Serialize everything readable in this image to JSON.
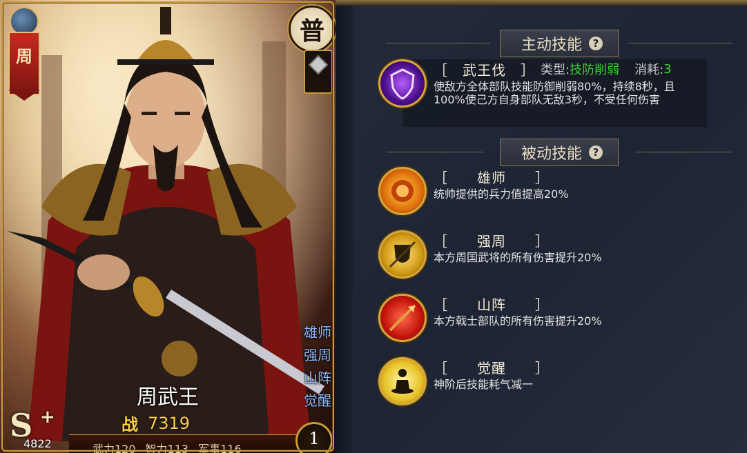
{
  "card": {
    "banner_char": "周",
    "grade_char": "普",
    "skill_tags": [
      "雄师",
      "强周",
      "山阵",
      "觉醒"
    ],
    "hero_name": "周武王",
    "power_label": "战",
    "power_value": "7319",
    "rank_letter": "S",
    "rank_plus": "+",
    "score": "4822",
    "stats": [
      "武力120",
      "智力113",
      "军事116"
    ],
    "level": "1"
  },
  "active_section": {
    "title": "主动技能",
    "help": "?",
    "skill": {
      "icon": "shield-burst-icon",
      "name": "［　武王伐　］",
      "type_label": "类型:",
      "type_value": "技防削弱",
      "cost_label": "消耗:",
      "cost_value": "3",
      "desc_line1": "使敌方全体部队技能防御削弱80%，持续8秒，且",
      "desc_line2": "100%使己方自身部队无敌3秒，不受任何伤害"
    }
  },
  "passive_section": {
    "title": "被动技能",
    "help": "?",
    "skills": [
      {
        "icon": "lion-icon",
        "name": "［　　雄师　　］",
        "desc": "统帅提供的兵力值提高20%"
      },
      {
        "icon": "shield-spear-icon",
        "name": "［　　强周　　］",
        "desc": "本方周国武将的所有伤害提升20%"
      },
      {
        "icon": "halberd-icon",
        "name": "［　　山阵　　］",
        "desc": "本方戟士部队的所有伤害提升20%"
      },
      {
        "icon": "meditation-icon",
        "name": "［　　觉醒　　］",
        "desc": "神阶后技能耗气减一"
      }
    ]
  },
  "colors": {
    "accent_gold": "#c99a3a",
    "type_green": "#3ad234",
    "tag_blue": "#8fb8ff",
    "power_yellow": "#ffce4a"
  }
}
